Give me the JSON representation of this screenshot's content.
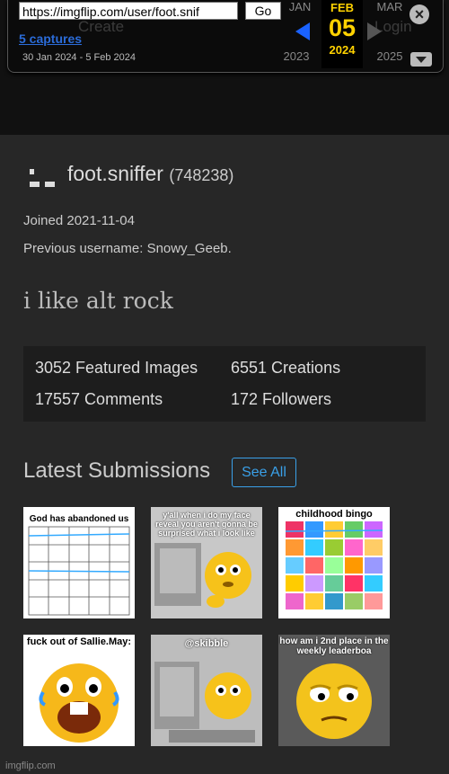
{
  "wayback": {
    "url": "https://imgflip.com/user/foot.snif",
    "go_label": "Go",
    "captures": "5 captures",
    "range": "30 Jan 2024 - 5 Feb 2024",
    "prev_month": "JAN",
    "cur_month": "FEB",
    "next_month": "MAR",
    "cur_day": "05",
    "prev_year": "2023",
    "cur_year": "2024",
    "next_year": "2025",
    "ghost_create": "Create",
    "ghost_login": "Login"
  },
  "profile": {
    "username": "foot.sniffer",
    "points": "(748238)",
    "joined": "Joined 2021-11-04",
    "previous": "Previous username: Snowy_Geeb.",
    "bio": "i like alt rock"
  },
  "stats": {
    "featured": "3052 Featured Images",
    "creations": "6551 Creations",
    "comments": "17557 Comments",
    "followers": "172 Followers"
  },
  "latest": {
    "title": "Latest Submissions",
    "see_all": "See All",
    "thumbs": [
      {
        "caption": "God has abandoned us"
      },
      {
        "caption": "y'all when i do my face reveal you aren't gonna be surprised what i look like"
      },
      {
        "caption": "childhood bingo"
      },
      {
        "caption": "fuck out of Sallie.May:"
      },
      {
        "caption": "@skibble"
      },
      {
        "caption": "how am i 2nd place in the weekly leaderboa"
      }
    ]
  },
  "footer": "imgflip.com"
}
